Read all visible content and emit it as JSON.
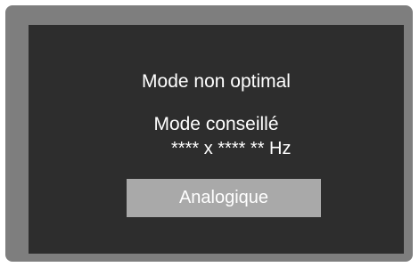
{
  "osd": {
    "title": "Mode non optimal",
    "recommended_label": "Mode conseillé",
    "recommended_value": "**** x ****    ** Hz",
    "input_button_label": "Analogique"
  },
  "colors": {
    "frame": "#7e7e7e",
    "screen": "#2d2d2d",
    "button": "#a9a9a9",
    "text": "#ffffff"
  }
}
